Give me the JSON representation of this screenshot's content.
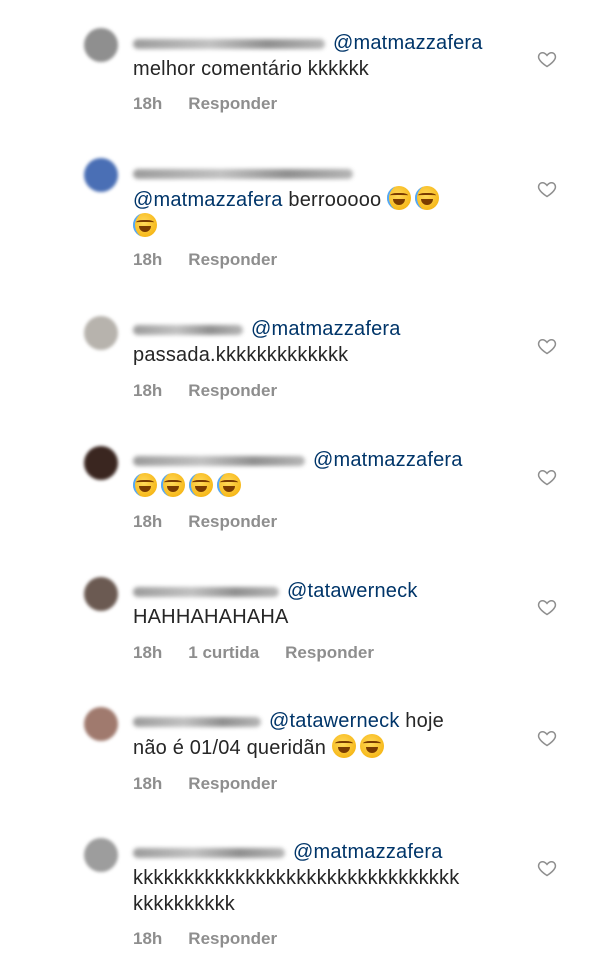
{
  "comments": [
    {
      "mention": "@matmazzafera",
      "text": "melhor comentário kkkkkk",
      "time": "18h",
      "likes": "",
      "reply": "Responder",
      "avatar_color": "#8f8f8f"
    },
    {
      "mention": "@matmazzafera",
      "text": " berrooooo",
      "time": "18h",
      "likes": "",
      "reply": "Responder",
      "avatar_color": "#4a6fb5",
      "emoji_count": 3
    },
    {
      "mention": "@matmazzafera",
      "text": "passada.kkkkkkkkkkkkk",
      "time": "18h",
      "likes": "",
      "reply": "Responder",
      "avatar_color": "#b7b3ad"
    },
    {
      "mention": "@matmazzafera",
      "text": "",
      "time": "18h",
      "likes": "",
      "reply": "Responder",
      "avatar_color": "#3a2620",
      "emoji_count": 4
    },
    {
      "mention": "@tatawerneck",
      "text": "HAHHAHAHAHA",
      "time": "18h",
      "likes": "1 curtida",
      "reply": "Responder",
      "avatar_color": "#6b5a52"
    },
    {
      "mention": "@tatawerneck",
      "text_inline": " hoje",
      "text": "não é 01/04 queridãn",
      "time": "18h",
      "likes": "",
      "reply": "Responder",
      "avatar_color": "#a07a6e",
      "emoji_count": 2
    },
    {
      "mention": "@matmazzafera",
      "text": "kkkkkkkkkkkkkkkkkkkkkkkkkkkkkkkk",
      "text2": "kkkkkkkkkk",
      "time": "18h",
      "likes": "",
      "reply": "Responder",
      "avatar_color": "#9d9d9d"
    }
  ]
}
